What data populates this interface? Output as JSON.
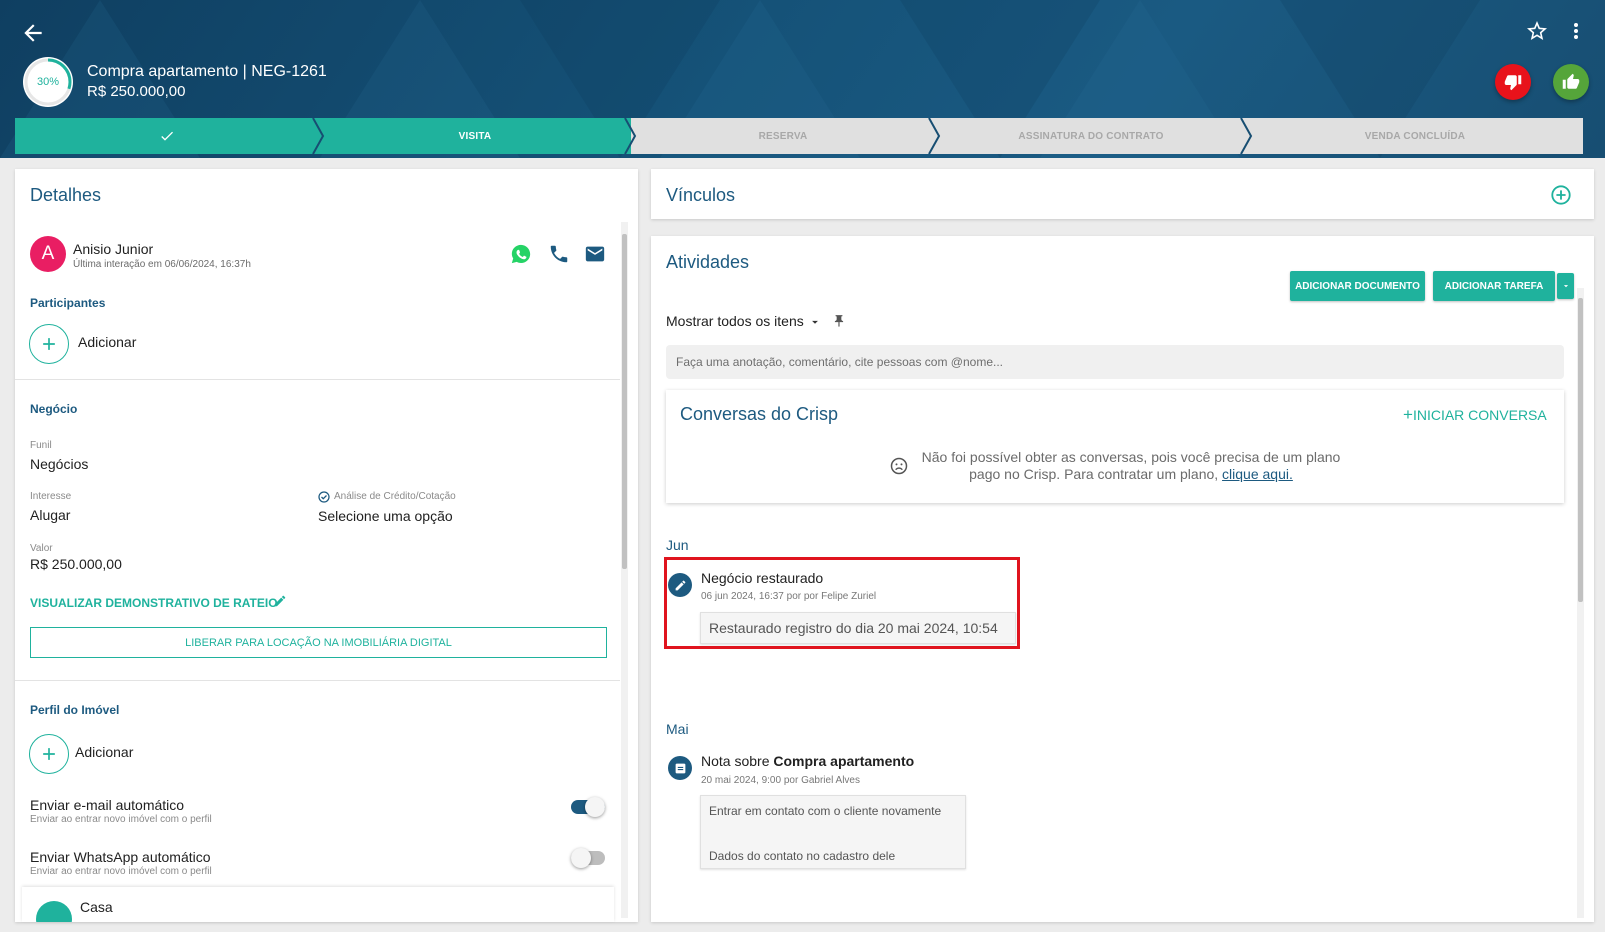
{
  "header": {
    "progress_text": "30%",
    "progress_fraction": 0.3,
    "deal_title": "Compra apartamento | NEG-1261",
    "deal_value": "R$ 250.000,00",
    "back_icon": "arrow-left-icon",
    "star_icon": "star-outline-icon",
    "more_icon": "more-vert-icon",
    "lose_icon": "thumb-down-icon",
    "win_icon": "thumb-up-icon",
    "lose_color": "#e8121b",
    "win_color": "#55a53a"
  },
  "pipeline": {
    "stages": [
      {
        "label": "",
        "status": "done"
      },
      {
        "label": "VISITA",
        "status": "active"
      },
      {
        "label": "RESERVA",
        "status": "todo"
      },
      {
        "label": "ASSINATURA DO CONTRATO",
        "status": "todo"
      },
      {
        "label": "VENDA CONCLUÍDA",
        "status": "todo"
      }
    ],
    "accent": "#1fb29d"
  },
  "details": {
    "title": "Detalhes",
    "contact": {
      "initial": "A",
      "name": "Anisio Junior",
      "last_interaction": "Última interação em 06/06/2024, 16:37h"
    },
    "participants_label": "Participantes",
    "participants_add": "Adicionar",
    "business_label": "Negócio",
    "funnel_label": "Funil",
    "funnel_value": "Negócios",
    "interest_label": "Interesse",
    "interest_value": "Alugar",
    "credit_label": "Análise de Crédito/Cotação",
    "credit_value": "Selecione uma opção",
    "value_label": "Valor",
    "value_value": "R$ 250.000,00",
    "view_split_link": "VISUALIZAR DEMONSTRATIVO DE RATEIO",
    "release_button": "LIBERAR PARA LOCAÇÃO NA IMOBILIÁRIA DIGITAL",
    "property_profile_label": "Perfil do Imóvel",
    "property_add": "Adicionar",
    "auto_email_title": "Enviar e-mail automático",
    "auto_email_sub": "Enviar ao entrar novo imóvel com o perfil",
    "auto_email_on": true,
    "auto_whatsapp_title": "Enviar WhatsApp automático",
    "auto_whatsapp_sub": "Enviar ao entrar novo imóvel com o perfil",
    "auto_whatsapp_on": false,
    "profile_item": "Casa"
  },
  "links": {
    "title": "Vínculos"
  },
  "activities": {
    "title": "Atividades",
    "add_document": "ADICIONAR DOCUMENTO",
    "add_task": "ADICIONAR TAREFA",
    "filter_label": "Mostrar todos os itens",
    "note_placeholder": "Faça uma anotação, comentário, cite pessoas com @nome...",
    "crisp": {
      "title": "Conversas do Crisp",
      "start_label": "INICIAR CONVERSA",
      "message_line1": "Não foi possível obter as conversas, pois você precisa de um plano",
      "message_line2": "pago no Crisp. Para contratar um plano,",
      "message_link": "clique aqui."
    },
    "months": [
      {
        "label": "Jun",
        "event_title": "Negócio restaurado",
        "event_meta": "06 jun 2024, 16:37 por por Felipe Zuriel",
        "event_detail": "Restaurado registro do dia 20 mai 2024, 10:54"
      },
      {
        "label": "Mai",
        "event_title_prefix": "Nota sobre",
        "event_title_bold": "Compra apartamento",
        "event_meta": "20 mai 2024, 9:00 por Gabriel Alves",
        "note_line1": "Entrar em contato com o cliente novamente",
        "note_line2": "Dados do contato no cadastro dele"
      }
    ],
    "highlight_color": "#e0141e"
  }
}
